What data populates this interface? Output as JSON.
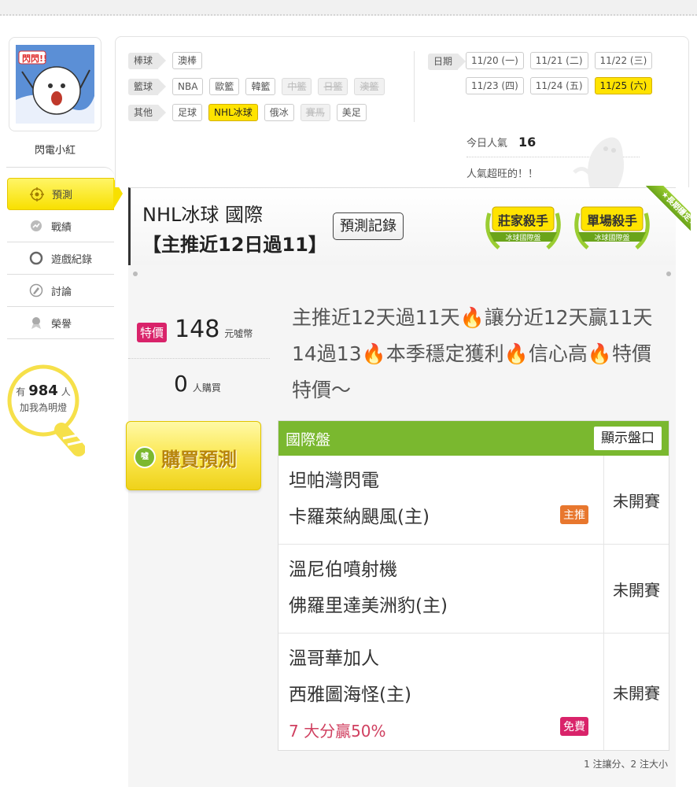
{
  "user": {
    "name": "閃電小紅",
    "avatar_text": "閃閃!!"
  },
  "nav": [
    {
      "label": "預測",
      "icon": "target-icon"
    },
    {
      "label": "戰績",
      "icon": "record-icon"
    },
    {
      "label": "遊戲紀錄",
      "icon": "circle-icon"
    },
    {
      "label": "討論",
      "icon": "discussion-icon"
    },
    {
      "label": "榮譽",
      "icon": "medal-icon"
    }
  ],
  "lamp": {
    "prefix": "有",
    "count": "984",
    "suffix": "人",
    "line2": "加我為明燈"
  },
  "filters": {
    "rows": [
      {
        "cat": "棒球",
        "tags": [
          {
            "label": "澳棒",
            "state": "normal"
          }
        ]
      },
      {
        "cat": "籃球",
        "tags": [
          {
            "label": "NBA",
            "state": "normal"
          },
          {
            "label": "歐籃",
            "state": "normal"
          },
          {
            "label": "韓籃",
            "state": "normal"
          },
          {
            "label": "中籃",
            "state": "disabled"
          },
          {
            "label": "日籃",
            "state": "disabled"
          },
          {
            "label": "澳籃",
            "state": "disabled"
          }
        ]
      },
      {
        "cat": "其他",
        "tags": [
          {
            "label": "足球",
            "state": "normal"
          },
          {
            "label": "NHL冰球",
            "state": "active"
          },
          {
            "label": "俄冰",
            "state": "normal"
          },
          {
            "label": "賽馬",
            "state": "disabled"
          },
          {
            "label": "美足",
            "state": "normal"
          }
        ]
      }
    ],
    "date_label": "日期",
    "dates": [
      {
        "label": "11/20 (一)",
        "state": "normal"
      },
      {
        "label": "11/21 (二)",
        "state": "normal"
      },
      {
        "label": "11/22 (三)",
        "state": "normal"
      },
      {
        "label": "11/23 (四)",
        "state": "normal"
      },
      {
        "label": "11/24 (五)",
        "state": "normal"
      },
      {
        "label": "11/25 (六)",
        "state": "active"
      }
    ]
  },
  "popularity": {
    "label": "今日人氣",
    "value": "16",
    "note": "人氣超旺的！！"
  },
  "title": {
    "league": "NHL冰球 國際",
    "subtitle": "【主推近12日過11】",
    "record_button": "預測記錄"
  },
  "badges": [
    {
      "main": "莊家殺手",
      "sub": "冰球國際盤"
    },
    {
      "main": "單場殺手",
      "sub": "冰球國際盤"
    }
  ],
  "ribbon": "★長期穩定★",
  "price": {
    "badge": "特價",
    "amount": "148",
    "unit": "元噓幣",
    "buyers": "0",
    "buyers_unit": "人購買"
  },
  "description": "主推近12天過11天🔥讓分近12天贏11天14過13🔥本季穩定獲利🔥信心高🔥特價特價～",
  "buy_button": {
    "label": "購買預測",
    "coin_text": "噓"
  },
  "matches_panel": {
    "title": "國際盤",
    "show_button": "顯示盤口",
    "rows": [
      {
        "away": "坦帕灣閃電",
        "home": "卡羅萊納颶風(主)",
        "status": "未開賽",
        "badge": "主推",
        "badge_color": "#e8772e",
        "extra": ""
      },
      {
        "away": "溫尼伯噴射機",
        "home": "佛羅里達美洲豹(主)",
        "status": "未開賽",
        "badge": "",
        "badge_color": "",
        "extra": ""
      },
      {
        "away": "溫哥華加人",
        "home": "西雅圖海怪(主)",
        "status": "未開賽",
        "badge": "免費",
        "badge_color": "#d9236a",
        "extra": "7 大分贏50%"
      }
    ]
  },
  "footnote": "1 注讓分、2 注大小",
  "colors": {
    "accent_yellow": "#ffe300",
    "green": "#7ab82f",
    "pink": "#d9236a",
    "orange": "#e8772e"
  }
}
